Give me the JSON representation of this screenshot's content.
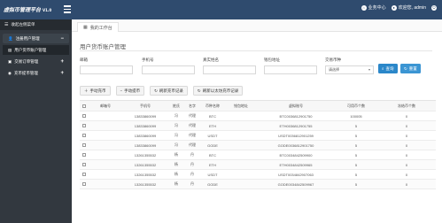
{
  "app": {
    "logo": "虚拟币管理平台",
    "version": "V1.0"
  },
  "header": {
    "business": "业务中心",
    "welcome": "欢迎您, admin",
    "logout_icon": "power-icon"
  },
  "sidebar": {
    "collapse_label": "收起左侧菜单",
    "groups": [
      {
        "label": "注册用户管理",
        "toggle": "−",
        "sub": [
          {
            "label": "用户货币账户管理"
          }
        ]
      },
      {
        "label": "交易订单管理",
        "toggle": "+"
      },
      {
        "label": "充币提币管理",
        "toggle": "+"
      }
    ]
  },
  "tabs": [
    {
      "label": "我的工作台"
    }
  ],
  "page": {
    "title": "用户货币账户管理"
  },
  "filters": {
    "email_label": "邮箱",
    "phone_label": "手机号",
    "name_label": "真实姓名",
    "wallet_label": "钱包地址",
    "currency_label": "交易币种",
    "currency_selected": "请选择",
    "search_button": "查询",
    "reset_button": "重置"
  },
  "actions": {
    "deposit": "手动充币",
    "withdraw": "手动提币",
    "refresh_deposit": "刷新充币记录",
    "refresh_eth": "刷新以太坊充币记录"
  },
  "table": {
    "columns": [
      "邮箱号",
      "手机号",
      "姓氏",
      "名字",
      "币种名称",
      "钱包地址",
      "虚拟账号",
      "可用币个数",
      "冻结币个数"
    ],
    "rows": [
      [
        "",
        "13833860099",
        "冯",
        "代理",
        "BTC",
        "",
        "BTC0036812901750",
        "100005",
        "0"
      ],
      [
        "",
        "13833860099",
        "冯",
        "代理",
        "ETH",
        "",
        "ETH0036812901755",
        "5",
        "0"
      ],
      [
        "",
        "13833860099",
        "冯",
        "代理",
        "USDT",
        "",
        "USDT0036812901259",
        "5",
        "0"
      ],
      [
        "",
        "13833860099",
        "冯",
        "代理",
        "GODE",
        "",
        "GODE0036812901750",
        "5",
        "0"
      ],
      [
        "",
        "13261355532",
        "杨",
        "丹",
        "BTC",
        "",
        "BTC0034842509900",
        "5",
        "0"
      ],
      [
        "",
        "13261355532",
        "杨",
        "丹",
        "ETH",
        "",
        "ETH0034842509965",
        "5",
        "0"
      ],
      [
        "",
        "13261355532",
        "杨",
        "丹",
        "USDT",
        "",
        "USDT0034842907063",
        "5",
        "0"
      ],
      [
        "",
        "13261355532",
        "杨",
        "丹",
        "GODE",
        "",
        "GODE0034842509967",
        "5",
        "0"
      ]
    ]
  }
}
